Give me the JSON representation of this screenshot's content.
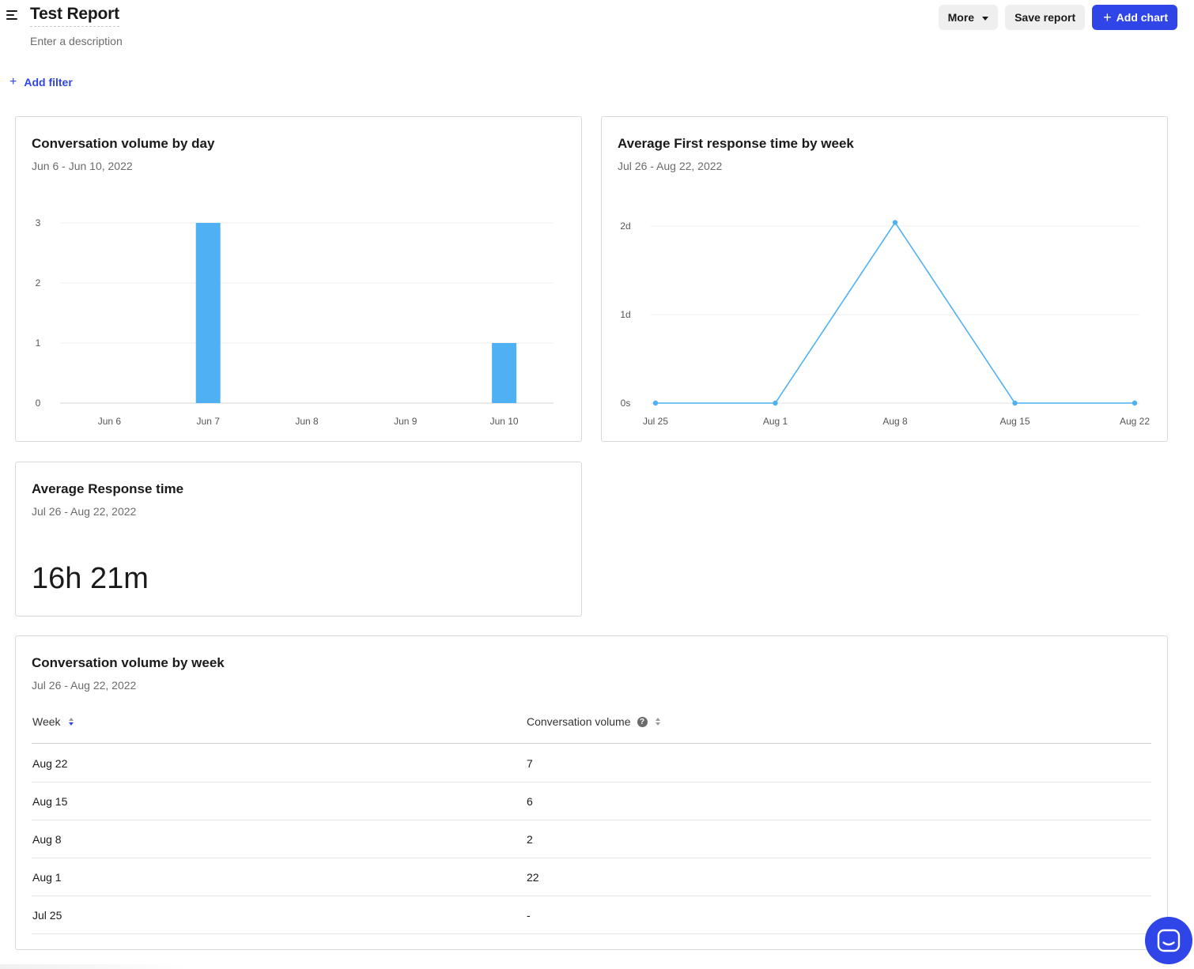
{
  "header": {
    "title": "Test Report",
    "description_placeholder": "Enter a description",
    "more_label": "More",
    "save_label": "Save report",
    "add_chart_label": "Add chart",
    "plus_symbol": "+"
  },
  "filters": {
    "add_filter_label": "Add filter"
  },
  "cards": {
    "volume_by_day": {
      "title": "Conversation volume by day",
      "range": "Jun 6 - Jun 10, 2022"
    },
    "first_response": {
      "title": "Average First response time by week",
      "range": "Jul 26 - Aug 22, 2022"
    },
    "avg_response": {
      "title": "Average Response time",
      "range": "Jul 26 - Aug 22, 2022",
      "value": "16h 21m"
    },
    "volume_by_week": {
      "title": "Conversation volume by week",
      "range": "Jul 26 - Aug 22, 2022",
      "columns": [
        "Week",
        "Conversation volume"
      ],
      "rows": [
        [
          "Aug 22",
          "7"
        ],
        [
          "Aug 15",
          "6"
        ],
        [
          "Aug 8",
          "2"
        ],
        [
          "Aug 1",
          "22"
        ],
        [
          "Jul 25",
          "-"
        ]
      ]
    }
  },
  "colors": {
    "accent": "#2f45e8",
    "bar": "#4fb1f3",
    "line": "#4fb1f3"
  },
  "chart_data": [
    {
      "type": "bar",
      "title": "Conversation volume by day",
      "categories": [
        "Jun 6",
        "Jun 7",
        "Jun 8",
        "Jun 9",
        "Jun 10"
      ],
      "values": [
        0,
        3,
        0,
        0,
        1
      ],
      "yticks": [
        "0",
        "1",
        "2",
        "3"
      ],
      "ylim": [
        0,
        3
      ],
      "grid": true
    },
    {
      "type": "line",
      "title": "Average First response time by week",
      "categories": [
        "Jul 25",
        "Aug 1",
        "Aug 8",
        "Aug 15",
        "Aug 22"
      ],
      "values_days": [
        0,
        0,
        2.04,
        0,
        0
      ],
      "yticks": [
        "0s",
        "1d",
        "2d"
      ],
      "ylim": [
        0,
        2
      ],
      "grid": true
    }
  ]
}
